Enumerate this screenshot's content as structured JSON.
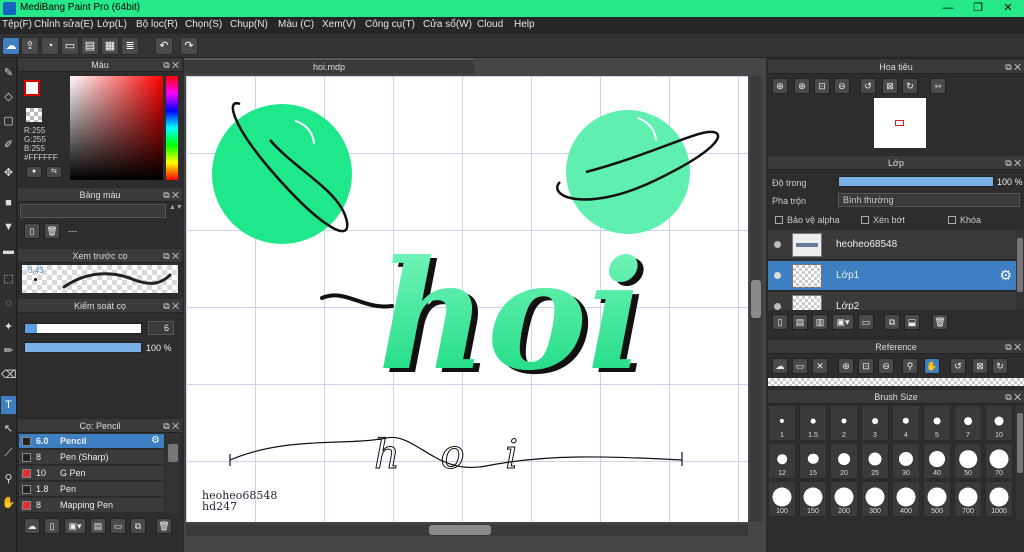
{
  "titlebar": {
    "title": "MediBang Paint Pro (64bit)",
    "minimize": "—",
    "restore": "❐",
    "close": "✕"
  },
  "menu": [
    "Tệp(F)",
    "Chỉnh sửa(E)",
    "Lớp(L)",
    "Bộ lọc(R)",
    "Chọn(S)",
    "Chụp(N)",
    "Màu (C)",
    "Xem(V)",
    "Công cụ(T)",
    "Cửa sổ(W)",
    "Cloud",
    "Help"
  ],
  "color_panel": {
    "title": "Màu",
    "r": "R:255",
    "g": "G:255",
    "b": "B:255",
    "hex": "#FFFFFF"
  },
  "palette_panel": {
    "title": "Bảng màu",
    "value": "---"
  },
  "brush_preview": {
    "title": "Xem trước cọ",
    "size": "0.43"
  },
  "brush_control": {
    "title": "Kiểm soát cọ",
    "size_value": "6",
    "opacity_value": "100 %",
    "opacity": 1.0
  },
  "brush_list": {
    "title": "Cọ: Pencil",
    "items": [
      {
        "size": "6.0",
        "name": "Pencil",
        "color": "#222222",
        "selected": true
      },
      {
        "size": "8",
        "name": "Pen (Sharp)",
        "color": "#222222",
        "selected": false
      },
      {
        "size": "10",
        "name": "G Pen",
        "color": "#e03030",
        "selected": false
      },
      {
        "size": "1.8",
        "name": "Pen",
        "color": "#222222",
        "selected": false
      },
      {
        "size": "8",
        "name": "Mapping Pen",
        "color": "#e03030",
        "selected": false
      }
    ]
  },
  "canvas": {
    "tab": "hoi.mdp",
    "main_word": "hoi",
    "script_word": "h o i",
    "signature_line1": "heoheo68548",
    "signature_line2": "hd247",
    "planet_color": "#1fe88a",
    "planet_light_color": "#5ff0b0"
  },
  "navigator": {
    "title": "Hoa tiêu"
  },
  "layer_panel": {
    "title": "Lớp",
    "opacity_label": "Độ trong",
    "opacity_value": "100 %",
    "opacity": 1.0,
    "blend_label": "Pha trộn",
    "blend_value": "Bình thường",
    "protect_alpha": "Bảo vệ alpha",
    "clipping": "Xén bớt",
    "lock": "Khóa",
    "layers": [
      {
        "name": "heoheo68548",
        "selected": false
      },
      {
        "name": "Lớp1",
        "selected": true
      },
      {
        "name": "Lớp2",
        "selected": false
      }
    ]
  },
  "reference_panel": {
    "title": "Reference"
  },
  "brush_size_panel": {
    "title": "Brush Size",
    "sizes": [
      "1",
      "1.5",
      "2",
      "3",
      "4",
      "5",
      "7",
      "10",
      "12",
      "15",
      "20",
      "25",
      "30",
      "40",
      "50",
      "70",
      "100",
      "150",
      "200",
      "300",
      "400",
      "500",
      "700",
      "1000"
    ]
  }
}
